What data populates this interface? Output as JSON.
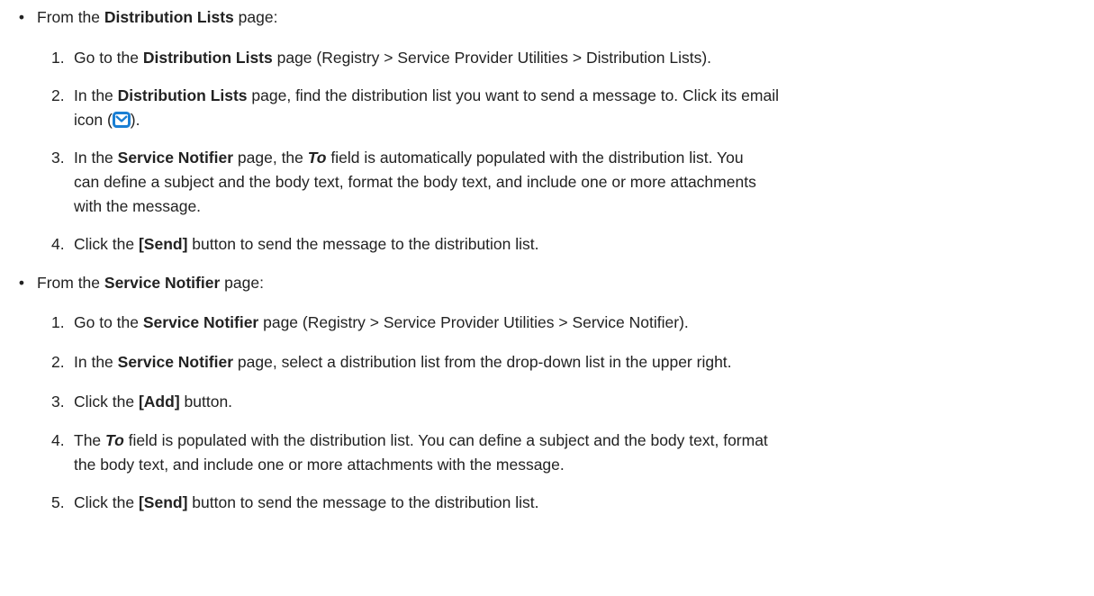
{
  "section1": {
    "bullet": "•",
    "intro_pre": "From the ",
    "intro_bold": "Distribution Lists",
    "intro_post": " page:",
    "steps": [
      {
        "num": "1.",
        "t1": "Go to the ",
        "b1": "Distribution Lists",
        "t2": " page (Registry > Service Provider Utilities > Distribution Lists)."
      },
      {
        "num": "2.",
        "t1": "In the ",
        "b1": "Distribution Lists",
        "t2": " page, find the distribution list you want to send a message to. Click its email",
        "t3": "icon (",
        "icon": "mail-icon",
        "t4": ")."
      },
      {
        "num": "3.",
        "t1": "In the ",
        "b1": "Service Notifier",
        "t2": " page, the ",
        "bi1": "To",
        "t3": " field is automatically populated with the distribution list. You",
        "t4": "can define a subject and the body text, format the body text, and include one or more attachments",
        "t5": "with the message."
      },
      {
        "num": "4.",
        "t1": "Click the ",
        "b1": "[Send]",
        "t2": " button to send the message to the distribution list."
      }
    ]
  },
  "section2": {
    "bullet": "•",
    "intro_pre": "From the ",
    "intro_bold": "Service Notifier",
    "intro_post": " page:",
    "steps": [
      {
        "num": "1.",
        "t1": "Go to the ",
        "b1": "Service Notifier",
        "t2": " page (Registry > Service Provider Utilities > Service Notifier)."
      },
      {
        "num": "2.",
        "t1": "In the ",
        "b1": "Service Notifier",
        "t2": " page, select a distribution list from the drop-down list in the upper right."
      },
      {
        "num": "3.",
        "t1": "Click the ",
        "b1": "[Add]",
        "t2": " button."
      },
      {
        "num": "4.",
        "t1": "The ",
        "bi1": "To",
        "t2": " field is populated with the distribution list. You can define a subject and the body text, format",
        "t3": "the body text, and include one or more attachments with the message."
      },
      {
        "num": "5.",
        "t1": "Click the ",
        "b1": "[Send]",
        "t2": " button to send the message to the distribution list."
      }
    ]
  },
  "colors": {
    "text": "#222222",
    "icon_blue": "#1a7fd4",
    "icon_fill": "#ffffff"
  }
}
